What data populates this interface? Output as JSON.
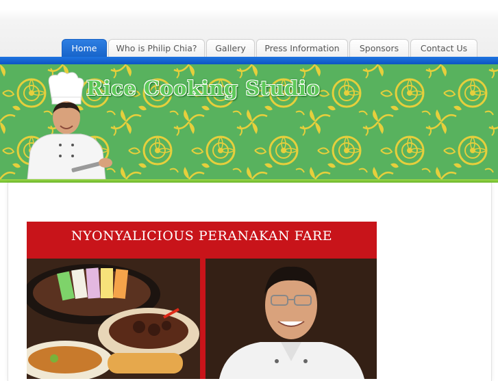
{
  "nav": {
    "tabs": [
      {
        "label": "Home",
        "active": true
      },
      {
        "label": "Who is Philip Chia?",
        "active": false
      },
      {
        "label": "Gallery",
        "active": false
      },
      {
        "label": "Press Information",
        "active": false
      },
      {
        "label": "Sponsors",
        "active": false
      },
      {
        "label": "Contact Us",
        "active": false
      }
    ]
  },
  "banner": {
    "title": "Rice Cooking Studio"
  },
  "promo": {
    "title": "NYONYALICIOUS PERANAKAN FARE"
  },
  "colors": {
    "nav_active": "#1a6ad6",
    "banner_green": "#58b25e",
    "pattern_yellow": "#e6cf3c",
    "promo_red": "#c8141a"
  }
}
